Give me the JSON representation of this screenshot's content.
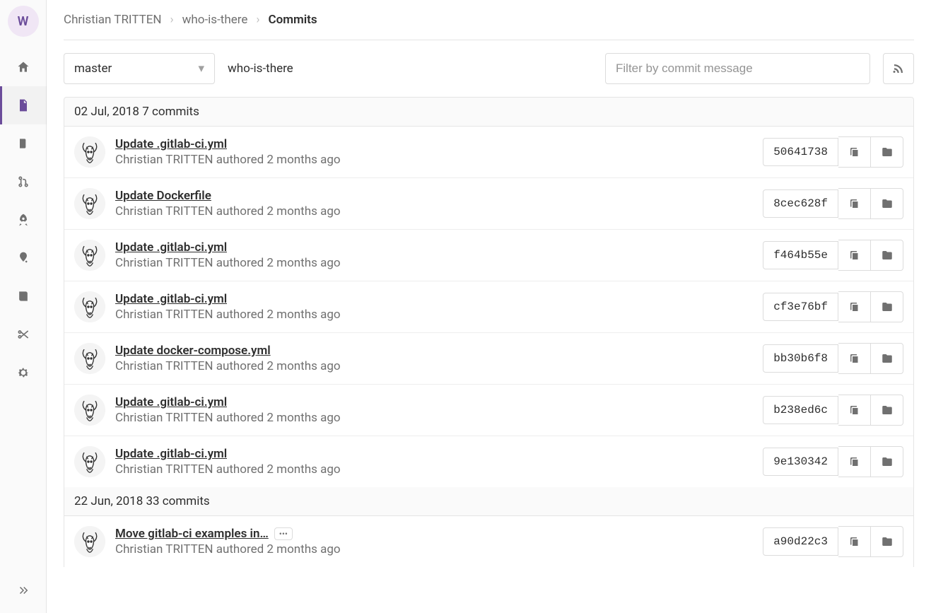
{
  "project_initial": "W",
  "breadcrumb": {
    "user": "Christian TRITTEN",
    "project": "who-is-there",
    "page": "Commits"
  },
  "branch": "master",
  "repo_path": "who-is-there",
  "filter_placeholder": "Filter by commit message",
  "groups": [
    {
      "date": "02 Jul, 2018",
      "count_label": "7 commits",
      "commits": [
        {
          "title": "Update .gitlab-ci.yml",
          "author": "Christian TRITTEN",
          "verb": "authored",
          "when": "2 months ago",
          "sha": "50641738",
          "more": false
        },
        {
          "title": "Update Dockerfile",
          "author": "Christian TRITTEN",
          "verb": "authored",
          "when": "2 months ago",
          "sha": "8cec628f",
          "more": false
        },
        {
          "title": "Update .gitlab-ci.yml",
          "author": "Christian TRITTEN",
          "verb": "authored",
          "when": "2 months ago",
          "sha": "f464b55e",
          "more": false
        },
        {
          "title": "Update .gitlab-ci.yml",
          "author": "Christian TRITTEN",
          "verb": "authored",
          "when": "2 months ago",
          "sha": "cf3e76bf",
          "more": false
        },
        {
          "title": "Update docker-compose.yml",
          "author": "Christian TRITTEN",
          "verb": "authored",
          "when": "2 months ago",
          "sha": "bb30b6f8",
          "more": false
        },
        {
          "title": "Update .gitlab-ci.yml",
          "author": "Christian TRITTEN",
          "verb": "authored",
          "when": "2 months ago",
          "sha": "b238ed6c",
          "more": false
        },
        {
          "title": "Update .gitlab-ci.yml",
          "author": "Christian TRITTEN",
          "verb": "authored",
          "when": "2 months ago",
          "sha": "9e130342",
          "more": false
        }
      ]
    },
    {
      "date": "22 Jun, 2018",
      "count_label": "33 commits",
      "commits": [
        {
          "title": "Move gitlab-ci examples in…",
          "author": "Christian TRITTEN",
          "verb": "authored",
          "when": "2 months ago",
          "sha": "a90d22c3",
          "more": true
        }
      ]
    }
  ]
}
